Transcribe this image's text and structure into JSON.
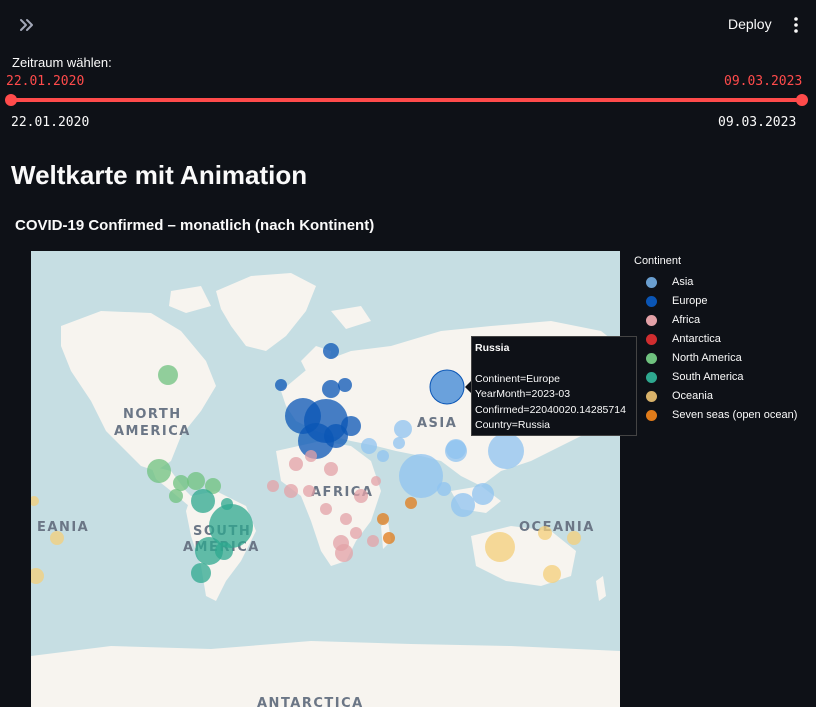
{
  "header": {
    "deploy_label": "Deploy",
    "expand_icon": "double-chevron-right-icon",
    "menu_icon": "kebab-menu-icon"
  },
  "slider": {
    "label": "Zeitraum wählen:",
    "start_value": "22.01.2020",
    "end_value": "09.03.2023",
    "min_label": "22.01.2020",
    "max_label": "09.03.2023",
    "color": "#ff4b4b"
  },
  "page": {
    "title": "Weltkarte mit Animation"
  },
  "chart": {
    "title": "COVID-19 Confirmed – monatlich (nach Kontinent)",
    "map_labels": {
      "north_america": [
        "NORTH",
        "AMERICA"
      ],
      "south_america": [
        "SOUTH",
        "AMERICA"
      ],
      "africa": "AFRICA",
      "asia": "ASIA",
      "oceania_right": "OCEANIA",
      "oceania_left": "EANIA",
      "antarctica": "ANTARCTICA"
    },
    "legend": {
      "title": "Continent",
      "items": [
        {
          "label": "Asia",
          "color": "#6a9fd0"
        },
        {
          "label": "Europe",
          "color": "#0a55b5"
        },
        {
          "label": "Africa",
          "color": "#e3a1a7"
        },
        {
          "label": "Antarctica",
          "color": "#d02d2f"
        },
        {
          "label": "North America",
          "color": "#6fc27f"
        },
        {
          "label": "South America",
          "color": "#2ea88f"
        },
        {
          "label": "Oceania",
          "color": "#d8b26a"
        },
        {
          "label": "Seven seas (open ocean)",
          "color": "#e07b1a"
        }
      ]
    },
    "tooltip": {
      "title": "Russia",
      "lines": [
        "Continent=Europe",
        "YearMonth=2023-03",
        "Confirmed=22040020.14285714",
        "Country=Russia"
      ]
    }
  }
}
